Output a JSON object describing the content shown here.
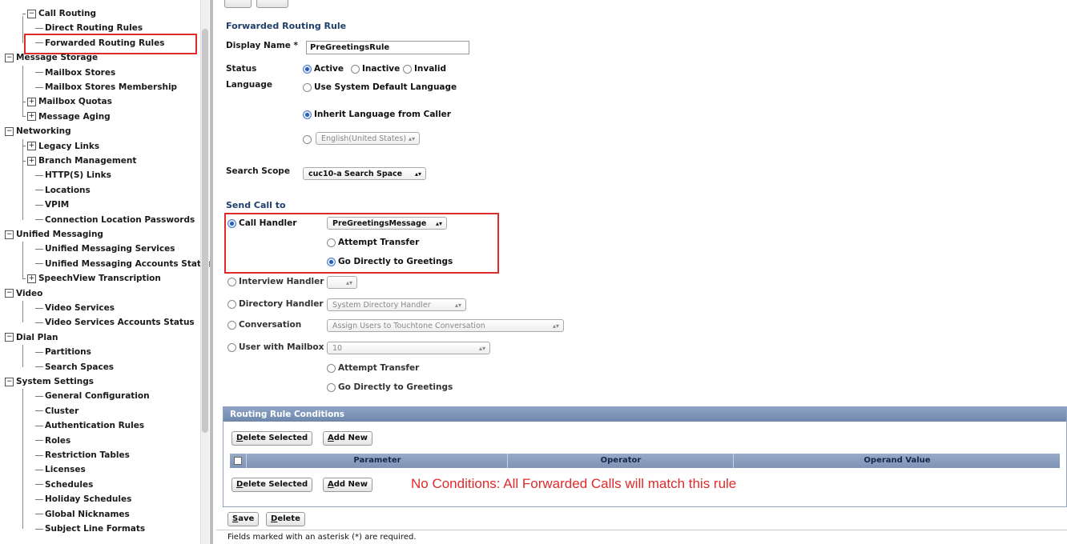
{
  "sidebar": {
    "items": [
      {
        "label": "Call Routing",
        "level": 1,
        "expander": "minus"
      },
      {
        "label": "Direct Routing Rules",
        "level": 2
      },
      {
        "label": "Forwarded Routing Rules",
        "level": 2,
        "selected": true
      },
      {
        "label": "Message Storage",
        "level": 0,
        "expander": "minus"
      },
      {
        "label": "Mailbox Stores",
        "level": 2
      },
      {
        "label": "Mailbox Stores Membership",
        "level": 2
      },
      {
        "label": "Mailbox Quotas",
        "level": 1,
        "expander": "plus"
      },
      {
        "label": "Message Aging",
        "level": 1,
        "expander": "plus"
      },
      {
        "label": "Networking",
        "level": 0,
        "expander": "minus"
      },
      {
        "label": "Legacy Links",
        "level": 1,
        "expander": "plus"
      },
      {
        "label": "Branch Management",
        "level": 1,
        "expander": "plus"
      },
      {
        "label": "HTTP(S) Links",
        "level": 2
      },
      {
        "label": "Locations",
        "level": 2
      },
      {
        "label": "VPIM",
        "level": 2
      },
      {
        "label": "Connection Location Passwords",
        "level": 2
      },
      {
        "label": "Unified Messaging",
        "level": 0,
        "expander": "minus"
      },
      {
        "label": "Unified Messaging Services",
        "level": 2
      },
      {
        "label": "Unified Messaging Accounts Status",
        "level": 2
      },
      {
        "label": "SpeechView Transcription",
        "level": 1,
        "expander": "plus"
      },
      {
        "label": "Video",
        "level": 0,
        "expander": "minus"
      },
      {
        "label": "Video Services",
        "level": 2
      },
      {
        "label": "Video Services Accounts Status",
        "level": 2
      },
      {
        "label": "Dial Plan",
        "level": 0,
        "expander": "minus"
      },
      {
        "label": "Partitions",
        "level": 2
      },
      {
        "label": "Search Spaces",
        "level": 2
      },
      {
        "label": "System Settings",
        "level": 0,
        "expander": "minus"
      },
      {
        "label": "General Configuration",
        "level": 2
      },
      {
        "label": "Cluster",
        "level": 2
      },
      {
        "label": "Authentication Rules",
        "level": 2
      },
      {
        "label": "Roles",
        "level": 2
      },
      {
        "label": "Restriction Tables",
        "level": 2
      },
      {
        "label": "Licenses",
        "level": 2
      },
      {
        "label": "Schedules",
        "level": 2
      },
      {
        "label": "Holiday Schedules",
        "level": 2
      },
      {
        "label": "Global Nicknames",
        "level": 2
      },
      {
        "label": "Subject Line Formats",
        "level": 2
      }
    ]
  },
  "form": {
    "section_title": "Forwarded Routing Rule",
    "display_name_label": "Display Name *",
    "display_name_value": "PreGreetingsRule",
    "status_label": "Status",
    "status_options": [
      "Active",
      "Inactive",
      "Invalid"
    ],
    "status_selected": "Active",
    "language_label": "Language",
    "language_opt_system": "Use System Default Language",
    "language_opt_inherit": "Inherit Language from Caller",
    "language_select": "English(United States)",
    "search_scope_label": "Search Scope",
    "search_scope_value": "cuc10-a Search Space"
  },
  "send_call": {
    "title": "Send Call to",
    "call_handler_label": "Call Handler",
    "call_handler_value": "PreGreetingsMessage",
    "attempt_transfer": "Attempt Transfer",
    "go_directly": "Go Directly to Greetings",
    "interview_handler_label": "Interview Handler",
    "interview_handler_value": "",
    "directory_handler_label": "Directory Handler",
    "directory_handler_value": "System Directory Handler",
    "conversation_label": "Conversation",
    "conversation_value": "Assign Users to Touchtone Conversation",
    "user_mailbox_label": "User with Mailbox",
    "user_mailbox_value": "10",
    "attempt_transfer_2": "Attempt Transfer",
    "go_directly_2": "Go Directly to Greetings"
  },
  "conditions": {
    "title": "Routing Rule Conditions",
    "delete_selected_first": "D",
    "delete_selected_rest": "elete Selected",
    "add_new_first": "A",
    "add_new_rest": "dd New",
    "columns": [
      "Parameter",
      "Operator",
      "Operand Value"
    ],
    "note": "No Conditions: All Forwarded Calls will match this rule"
  },
  "footer": {
    "save_first": "S",
    "save_rest": "ave",
    "delete_first": "D",
    "delete_rest": "elete",
    "asterisk_note": "Fields marked with an asterisk (*) are required."
  }
}
